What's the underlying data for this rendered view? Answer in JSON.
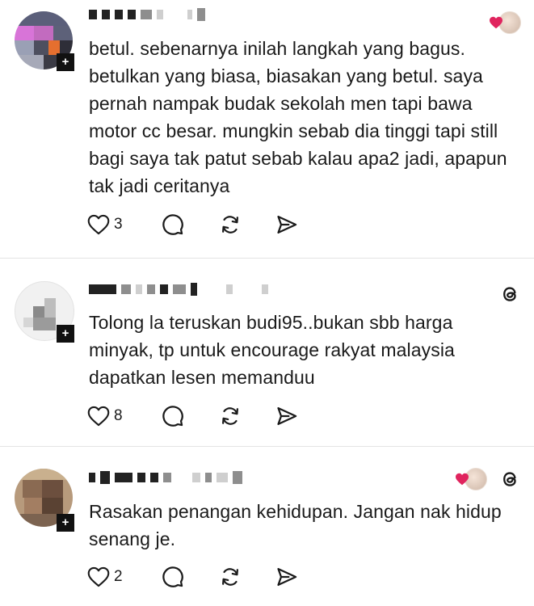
{
  "comments": [
    {
      "text": "betul. sebenarnya inilah langkah yang bagus. betulkan yang biasa, biasakan yang betul. saya pernah nampak budak sekolah men tapi bawa motor cc besar. mungkin sebab dia tinggi tapi still bagi saya tak patut sebab kalau apa2 jadi, apapun tak jadi ceritanya",
      "likes": "3",
      "liked_by_author": true,
      "threads_logo": false
    },
    {
      "text": "Tolong la teruskan budi95..bukan sbb harga minyak, tp untuk encourage rakyat malaysia dapatkan lesen memanduu",
      "likes": "8",
      "liked_by_author": false,
      "threads_logo": true
    },
    {
      "text": "Rasakan penangan kehidupan. Jangan nak hidup senang je.",
      "likes": "2",
      "liked_by_author": true,
      "threads_logo": true
    }
  ],
  "icons": {
    "like": "heart-outline-icon",
    "reply": "comment-bubble-icon",
    "repost": "repost-arrows-icon",
    "share": "send-icon",
    "threads": "threads-logo-icon"
  },
  "colors": {
    "text": "#1a1a1a",
    "heart_red": "#e0245e",
    "divider": "#e4e4e4"
  }
}
